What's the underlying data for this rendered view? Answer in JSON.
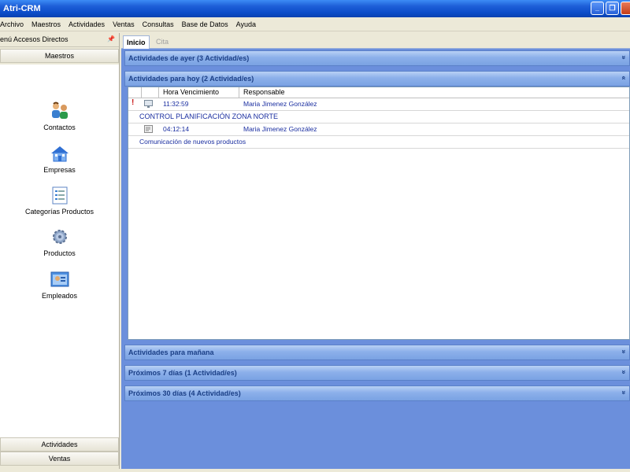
{
  "window": {
    "title": "Atri-CRM"
  },
  "menu": [
    "Archivo",
    "Maestros",
    "Actividades",
    "Ventas",
    "Consultas",
    "Base de Datos",
    "Ayuda"
  ],
  "sidebar": {
    "header": "enú Accesos Directos",
    "section_top": "Maestros",
    "items": [
      {
        "label": "Contactos",
        "icon": "contacts-icon"
      },
      {
        "label": "Empresas",
        "icon": "company-building-icon"
      },
      {
        "label": "Categorías Productos",
        "icon": "categories-icon"
      },
      {
        "label": "Productos",
        "icon": "gear-products-icon"
      },
      {
        "label": "Empleados",
        "icon": "employees-icon"
      }
    ],
    "bottom_sections": [
      "Actividades",
      "Ventas"
    ]
  },
  "tabs": [
    {
      "label": "Inicio",
      "active": true
    },
    {
      "label": "Cita",
      "active": false
    }
  ],
  "groups": {
    "ayer": "Actividades de ayer (3 Actividad/es)",
    "hoy": "Actividades para hoy (2 Actividad/es)",
    "manana": "Actividades  para mañana",
    "siete": "Próximos 7 días (1 Actividad/es)",
    "treinta": "Próximos 30 días (4 Actividad/es)"
  },
  "grid": {
    "columns": [
      "Hora Vencimiento",
      "Responsable"
    ],
    "rows": [
      {
        "important": "!",
        "time": "11:32:59",
        "responsible": "Maria Jimenez González",
        "subject": "CONTROL PLANIFICACIÓN ZONA NORTE"
      },
      {
        "important": "",
        "time": "04:12:14",
        "responsible": "Maria Jimenez González",
        "subject": "Comunicación de nuevos productos"
      }
    ]
  },
  "colors": {
    "titlebar": "#0b4cc8",
    "content_bg": "#6b8fdc",
    "group_text": "#1b3f86",
    "link_text": "#1a2ea0"
  }
}
